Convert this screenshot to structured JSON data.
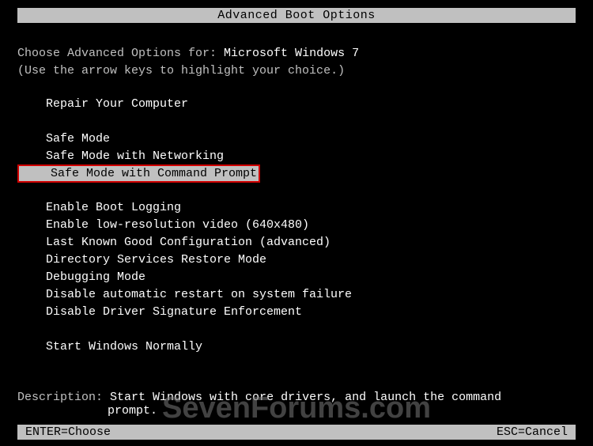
{
  "title": "Advanced Boot Options",
  "choose_label": "Choose Advanced Options for: ",
  "os_name": "Microsoft Windows 7",
  "hint": "(Use the arrow keys to highlight your choice.)",
  "groups": [
    [
      "Repair Your Computer"
    ],
    [
      "Safe Mode",
      "Safe Mode with Networking",
      "Safe Mode with Command Prompt"
    ],
    [
      "Enable Boot Logging",
      "Enable low-resolution video (640x480)",
      "Last Known Good Configuration (advanced)",
      "Directory Services Restore Mode",
      "Debugging Mode",
      "Disable automatic restart on system failure",
      "Disable Driver Signature Enforcement"
    ],
    [
      "Start Windows Normally"
    ]
  ],
  "selected": "Safe Mode with Command Prompt",
  "description_label": "Description: ",
  "description_value_l1": "Start Windows with core drivers, and launch the command",
  "description_value_l2": "prompt.",
  "footer": {
    "enter": "ENTER=Choose",
    "esc": "ESC=Cancel"
  },
  "watermark": "SevenForums.com"
}
